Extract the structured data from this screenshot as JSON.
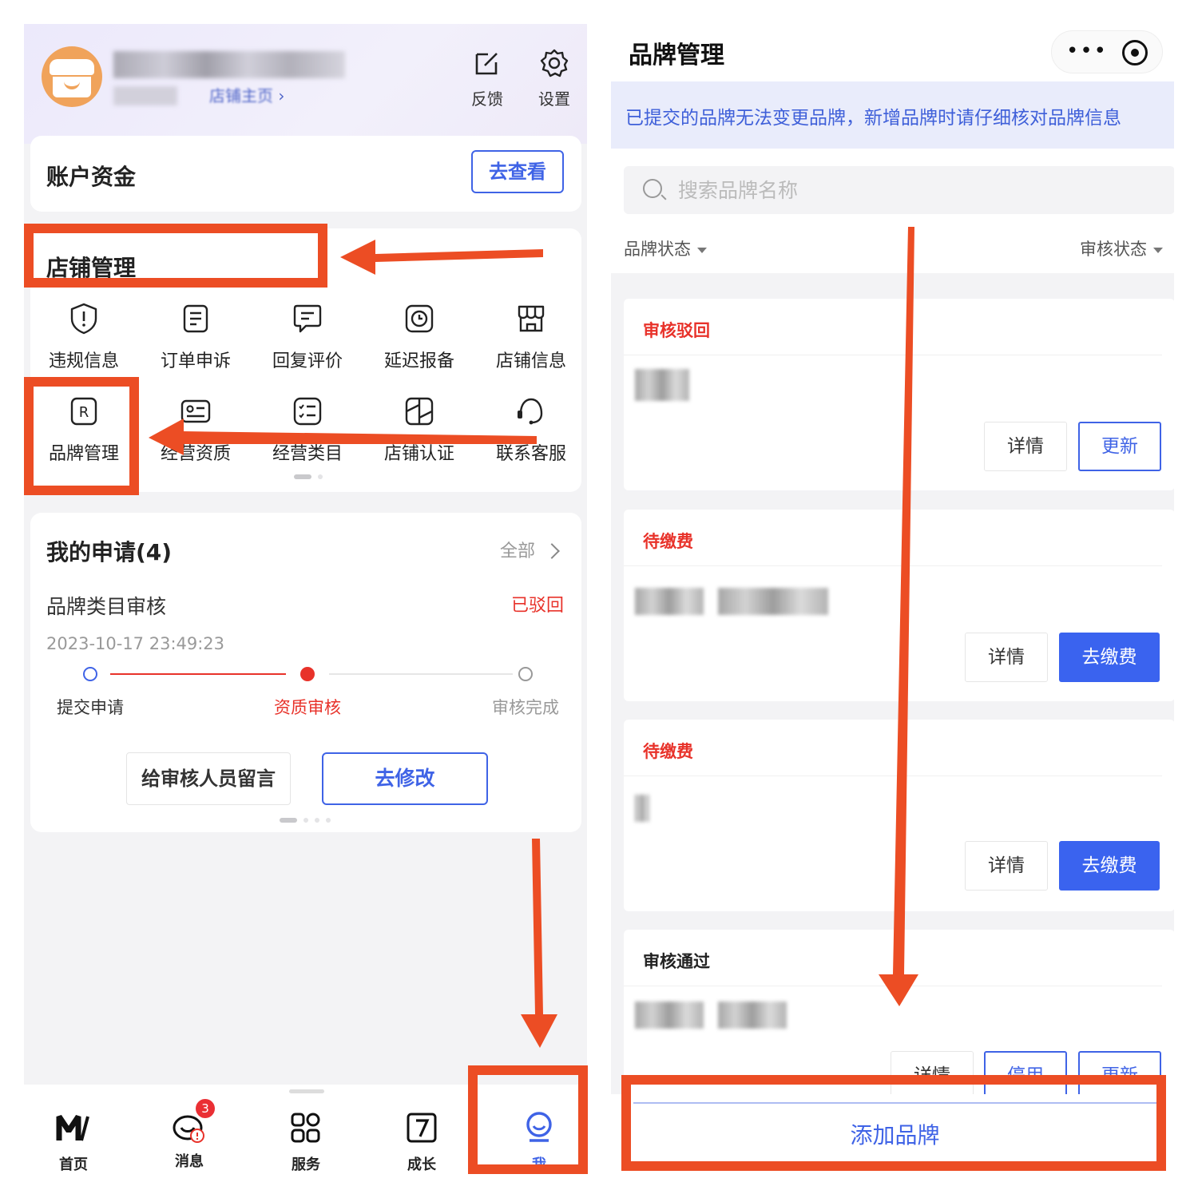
{
  "left": {
    "header": {
      "store_home_link": "店铺主页",
      "feedback_label": "反馈",
      "settings_label": "设置"
    },
    "account_funds": {
      "title": "账户资金",
      "view_button": "去查看"
    },
    "store_management": {
      "title": "店铺管理",
      "items": [
        {
          "label": "违规信息",
          "icon": "shield-alert-icon"
        },
        {
          "label": "订单申诉",
          "icon": "order-document-icon"
        },
        {
          "label": "回复评价",
          "icon": "comment-icon"
        },
        {
          "label": "延迟报备",
          "icon": "clock-icon"
        },
        {
          "label": "店铺信息",
          "icon": "store-icon"
        },
        {
          "label": "品牌管理",
          "icon": "brand-r-icon"
        },
        {
          "label": "经营资质",
          "icon": "id-card-icon"
        },
        {
          "label": "经营类目",
          "icon": "category-list-icon"
        },
        {
          "label": "店铺认证",
          "icon": "certification-icon"
        },
        {
          "label": "联系客服",
          "icon": "headset-icon"
        }
      ]
    },
    "my_applications": {
      "title": "我的申请(4)",
      "all_link": "全部",
      "item": {
        "title": "品牌类目审核",
        "status": "已驳回",
        "time": "2023-10-17 23:49:23",
        "steps": [
          "提交申请",
          "资质审核",
          "审核完成"
        ],
        "current_step": 2
      },
      "message_button": "给审核人员留言",
      "modify_button": "去修改"
    },
    "bottom_nav": {
      "tabs": [
        {
          "label": "首页",
          "icon": "m-logo-icon"
        },
        {
          "label": "消息",
          "icon": "message-icon",
          "badge": "3"
        },
        {
          "label": "服务",
          "icon": "services-grid-icon"
        },
        {
          "label": "成长",
          "icon": "growth-icon"
        },
        {
          "label": "我",
          "icon": "profile-icon",
          "active": true
        }
      ]
    }
  },
  "right": {
    "nav": {
      "title": "品牌管理"
    },
    "notice": "已提交的品牌无法变更品牌，新增品牌时请仔细核对品牌信息",
    "search": {
      "placeholder": "搜索品牌名称"
    },
    "filters": {
      "brand_status": "品牌状态",
      "review_status": "审核状态"
    },
    "brand_cards": [
      {
        "status": "审核驳回",
        "status_color": "#e8322a",
        "detail_label": "详情",
        "action_label": "更新"
      },
      {
        "status": "待缴费",
        "status_color": "#e8322a",
        "detail_label": "详情",
        "action_label": "去缴费"
      },
      {
        "status": "待缴费",
        "status_color": "#e8322a",
        "detail_label": "详情",
        "action_label": "去缴费"
      },
      {
        "status": "审核通过",
        "status_color": "#222222",
        "detail_label": "详情",
        "action_labels": [
          "停用",
          "更新"
        ]
      }
    ],
    "add_brand_button": "添加品牌"
  },
  "colors": {
    "accent_blue": "#3f63e6",
    "error_red": "#e8322a",
    "annotation_orange": "#ec4d24"
  }
}
